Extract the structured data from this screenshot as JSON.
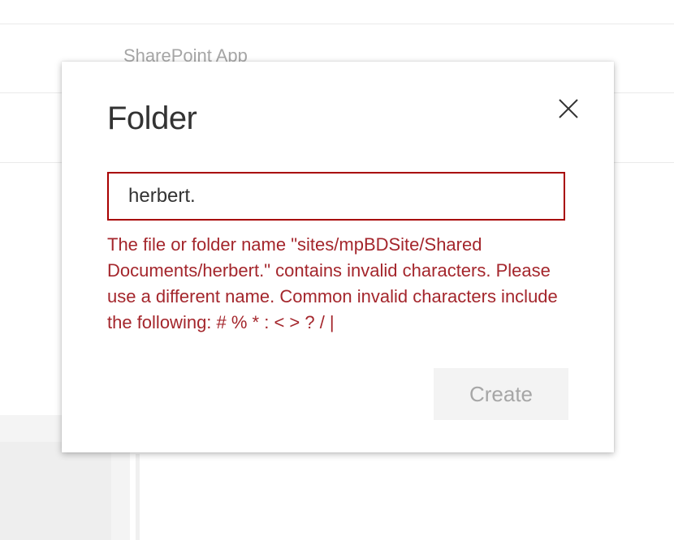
{
  "background": {
    "app_title": "SharePoint App"
  },
  "dialog": {
    "title": "Folder",
    "close_icon": "close-icon",
    "input_value": "herbert.",
    "error_message": "The file or folder name \"sites/mpBDSite/Shared Documents/herbert.\" contains invalid characters. Please use a different name. Common invalid characters include the following: # % * : < > ? / |",
    "create_label": "Create",
    "create_disabled": true
  },
  "colors": {
    "error": "#a4262c",
    "input_error_border": "#a80000",
    "disabled_button_bg": "#f3f3f3",
    "disabled_button_text": "#a6a6a6"
  }
}
